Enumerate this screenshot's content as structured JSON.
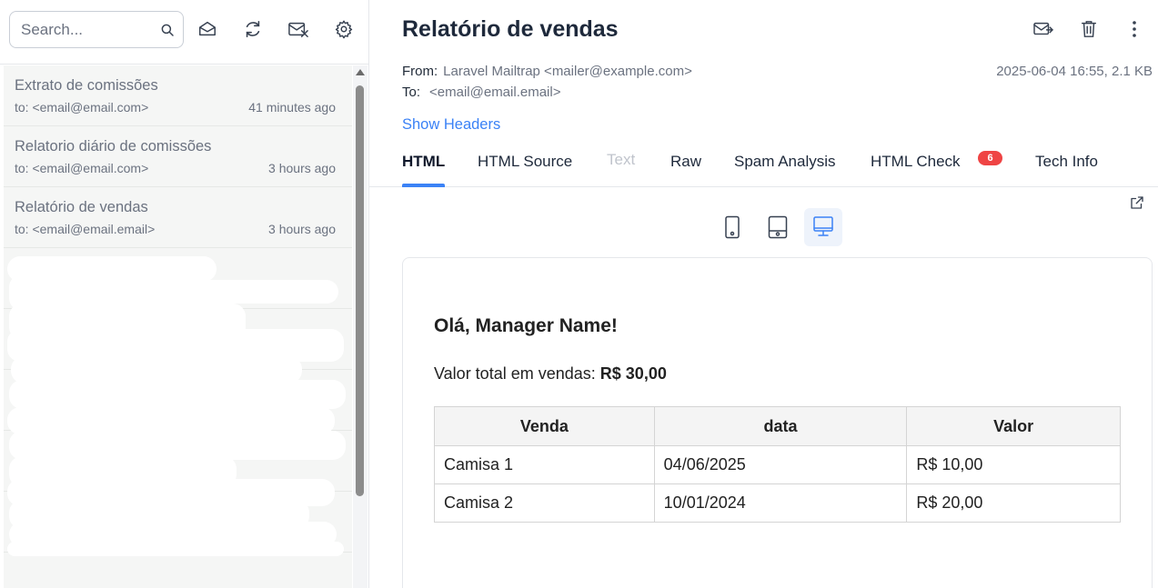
{
  "sidebar": {
    "search": {
      "placeholder": "Search...",
      "value": ""
    },
    "messages": [
      {
        "subject": "Extrato de comissões",
        "to": "to: <email@email.com>",
        "time": "41 minutes ago"
      },
      {
        "subject": "Relatorio diário de comissões",
        "to": "to: <email@email.com>",
        "time": "3 hours ago"
      },
      {
        "subject": "Relatório de vendas",
        "to": "to: <email@email.email>",
        "time": "3 hours ago"
      }
    ]
  },
  "message": {
    "subject": "Relatório de vendas",
    "from_label": "From:",
    "from_value": "Laravel Mailtrap <mailer@example.com>",
    "to_label": "To:",
    "to_value": "<email@email.email>",
    "date_size": "2025-06-04 16:55, 2.1 KB",
    "show_headers": "Show Headers"
  },
  "tabs": [
    {
      "label": "HTML",
      "state": "active"
    },
    {
      "label": "HTML Source",
      "state": "normal"
    },
    {
      "label": "Text",
      "state": "disabled"
    },
    {
      "label": "Raw",
      "state": "normal"
    },
    {
      "label": "Spam Analysis",
      "state": "normal"
    },
    {
      "label": "HTML Check",
      "state": "normal",
      "badge": "6"
    },
    {
      "label": "Tech Info",
      "state": "normal"
    }
  ],
  "devices": [
    "mobile-icon",
    "tablet-icon",
    "desktop-icon"
  ],
  "active_device": "desktop-icon",
  "email_body": {
    "greeting": "Olá, Manager Name!",
    "total_label": "Valor total em vendas:",
    "total_value": "R$ 30,00",
    "table": {
      "headers": [
        "Venda",
        "data",
        "Valor"
      ],
      "rows": [
        [
          "Camisa 1",
          "04/06/2025",
          "R$ 10,00"
        ],
        [
          "Camisa 2",
          "10/01/2024",
          "R$ 20,00"
        ]
      ]
    }
  },
  "colors": {
    "accent": "#3b82f6",
    "badge": "#ef4444",
    "list_bg": "#f5f6f5"
  }
}
